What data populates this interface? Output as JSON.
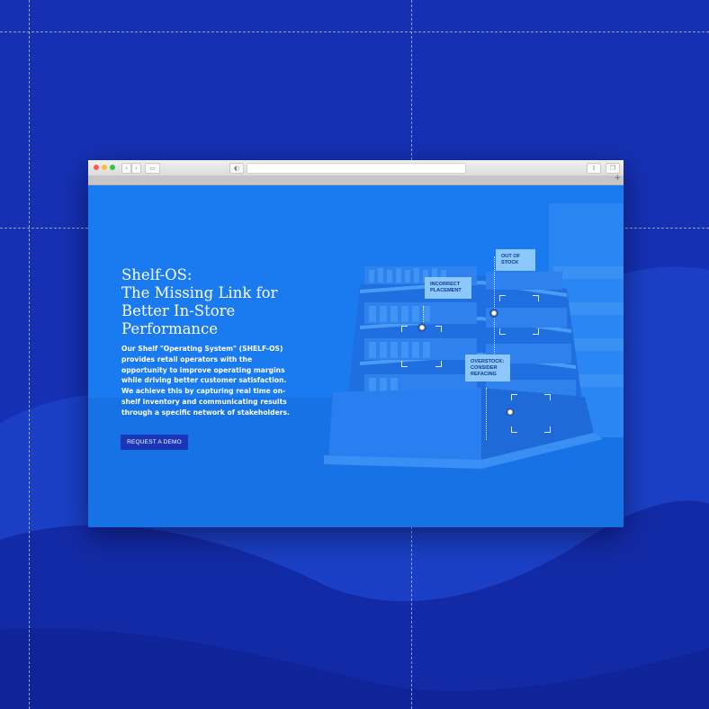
{
  "page": {
    "accent_color": "#1a7bf0",
    "background_color": "#1530b3",
    "button_color": "#1b36b8",
    "tag_color": "#8cc8fb",
    "marker_color": "#cfcf3c"
  },
  "browser": {
    "window_controls": [
      "close-icon",
      "minimize-icon",
      "zoom-icon"
    ],
    "toolbar_icons": [
      "back-arrow-icon",
      "forward-arrow-icon",
      "sidebar-icon",
      "privacy-shield-icon",
      "share-icon",
      "tabs-icon",
      "new-tab-plus-icon"
    ],
    "url": "",
    "new_tab_label": "+"
  },
  "hero": {
    "headline": "Shelf-OS:\nThe Missing Link for\nBetter In-Store\nPerformance",
    "body": "Our Shelf \"Operating System\" (SHELF-OS) provides retail operators with the opportunity to improve operating margins while driving better customer satisfaction. We achieve this by capturing real time on-shelf inventory and communicating results through a specific network of stakeholders.",
    "cta_label": "REQUEST A DEMO"
  },
  "annotations": [
    {
      "label": "OUT OF\nSTOCK"
    },
    {
      "label": "INCORRECT\nPLACEMENT"
    },
    {
      "label": "OVERSTOCK:\nCONSIDER\nREFACING"
    }
  ]
}
